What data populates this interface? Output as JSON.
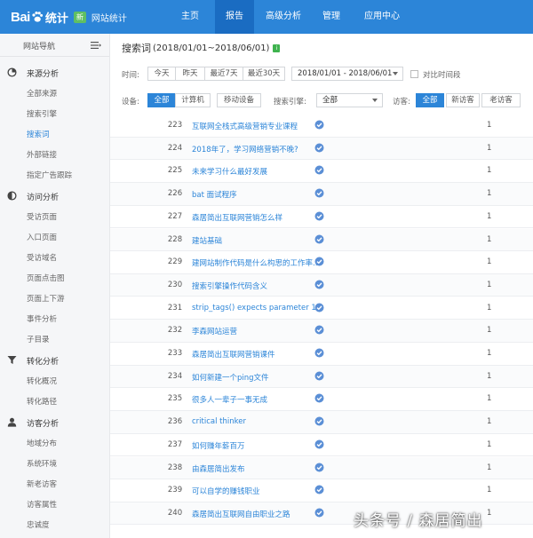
{
  "brand": {
    "logo_text": "Bai",
    "logo_tj": "统计",
    "badge": "新",
    "subtitle": "网站统计"
  },
  "nav": [
    {
      "label": "主页"
    },
    {
      "label": "报告"
    },
    {
      "label": "高级分析"
    },
    {
      "label": "管理"
    },
    {
      "label": "应用中心"
    }
  ],
  "sidebar": {
    "header": "网站导航",
    "groups": [
      {
        "label": "来源分析",
        "icon": "pie-icon",
        "items": [
          "全部来源",
          "搜索引擎",
          "搜索词",
          "外部链接",
          "指定广告跟踪"
        ]
      },
      {
        "label": "访问分析",
        "icon": "half-circle-icon",
        "items": [
          "受访页面",
          "入口页面",
          "受访域名",
          "页面点击图",
          "页面上下游",
          "事件分析",
          "子目录"
        ]
      },
      {
        "label": "转化分析",
        "icon": "funnel-icon",
        "items": [
          "转化概况",
          "转化路径"
        ]
      },
      {
        "label": "访客分析",
        "icon": "user-icon",
        "items": [
          "地域分布",
          "系统环境",
          "新老访客",
          "访客属性",
          "忠诚度"
        ]
      }
    ],
    "active_item": "搜索词"
  },
  "report": {
    "title": "搜索词",
    "range": "(2018/01/01~2018/06/01)",
    "tag": "i"
  },
  "filters": {
    "time_label": "时间:",
    "time_buttons": [
      "今天",
      "昨天",
      "最近7天",
      "最近30天"
    ],
    "date_range": "2018/01/01 - 2018/06/01",
    "compare_label": "对比时间段",
    "device_label": "设备:",
    "device_buttons": [
      "全部",
      "计算机",
      "移动设备"
    ],
    "engine_label": "搜索引擎:",
    "engine_value": "全部",
    "visitor_label": "访客:",
    "visitor_buttons": [
      "全部",
      "新访客",
      "老访客"
    ]
  },
  "table": {
    "rows": [
      {
        "num": "223",
        "keyword": "互联网全栈式高级营销专业课程",
        "value": "1"
      },
      {
        "num": "224",
        "keyword": "2018年了，学习网络营销不晚?",
        "value": "1"
      },
      {
        "num": "225",
        "keyword": "未来学习什么最好发展",
        "value": "1"
      },
      {
        "num": "226",
        "keyword": "bat 面试程序",
        "value": "1"
      },
      {
        "num": "227",
        "keyword": "森居简出互联网营销怎么样",
        "value": "1"
      },
      {
        "num": "228",
        "keyword": "建站基础",
        "value": "1"
      },
      {
        "num": "229",
        "keyword": "建网站制作代码是什么构思的工作率...",
        "value": "1"
      },
      {
        "num": "230",
        "keyword": "搜索引擎操作代码含义",
        "value": "1"
      },
      {
        "num": "231",
        "keyword": "strip_tags() expects parameter 1",
        "value": "1"
      },
      {
        "num": "232",
        "keyword": "李森网站运营",
        "value": "1"
      },
      {
        "num": "233",
        "keyword": "森居简出互联网营销课件",
        "value": "1"
      },
      {
        "num": "234",
        "keyword": "如何新建一个ping文件",
        "value": "1"
      },
      {
        "num": "235",
        "keyword": "很多人一辈子一事无成",
        "value": "1"
      },
      {
        "num": "236",
        "keyword": "critical thinker",
        "value": "1"
      },
      {
        "num": "237",
        "keyword": "如何赚年薪百万",
        "value": "1"
      },
      {
        "num": "238",
        "keyword": "由森居简出发布",
        "value": "1"
      },
      {
        "num": "239",
        "keyword": "可以自学的赚钱职业",
        "value": "1"
      },
      {
        "num": "240",
        "keyword": "森居简出互联网自由职业之路",
        "value": "1"
      }
    ]
  },
  "watermark": "头条号 / 森居简出",
  "colors": {
    "primary": "#2c85d8",
    "nav_active": "#1a6cc2",
    "badge": "#5fbf63"
  }
}
